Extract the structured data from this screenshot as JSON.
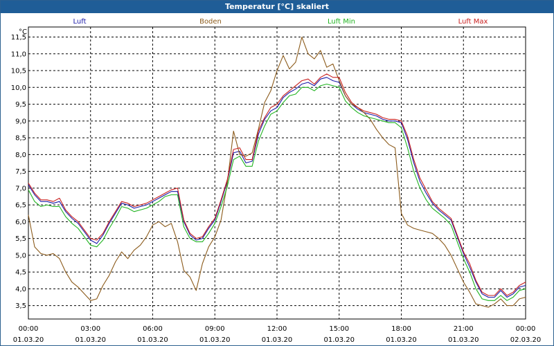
{
  "window": {
    "title": "Temperatur [°C] skaliert"
  },
  "chart_data": {
    "type": "line",
    "title": "Temperatur [°C] skaliert",
    "ylabel": "°C",
    "ylim": [
      3.1,
      11.8
    ],
    "yticks": [
      3.5,
      4.0,
      4.5,
      5.0,
      5.5,
      6.0,
      6.5,
      7.0,
      7.5,
      8.0,
      8.5,
      9.0,
      9.5,
      10.0,
      10.5,
      11.0,
      11.5
    ],
    "ytick_labels": [
      "3,5",
      "4,0",
      "4,5",
      "5,0",
      "5,5",
      "6,0",
      "6,5",
      "7,0",
      "7,5",
      "8,0",
      "8,5",
      "9,0",
      "9,5",
      "10,0",
      "10,5",
      "11,0",
      "11,5"
    ],
    "xlim": [
      0,
      24
    ],
    "xticks": [
      {
        "x": 0,
        "time": "00:00",
        "date": "01.03.20"
      },
      {
        "x": 3,
        "time": "03:00",
        "date": "01.03.20"
      },
      {
        "x": 6,
        "time": "06:00",
        "date": "01.03.20"
      },
      {
        "x": 9,
        "time": "09:00",
        "date": "01.03.20"
      },
      {
        "x": 12,
        "time": "12:00",
        "date": "01.03.20"
      },
      {
        "x": 15,
        "time": "15:00",
        "date": "01.03.20"
      },
      {
        "x": 18,
        "time": "18:00",
        "date": "01.03.20"
      },
      {
        "x": 21,
        "time": "21:00",
        "date": "01.03.20"
      },
      {
        "x": 24,
        "time": "00:00",
        "date": "02.03.20"
      }
    ],
    "grid": true,
    "legend_position": "top",
    "series": [
      {
        "name": "Luft",
        "color": "#1a1aa8",
        "x": [
          0,
          0.3,
          0.6,
          0.9,
          1.2,
          1.5,
          1.8,
          2.1,
          2.4,
          2.7,
          3.0,
          3.3,
          3.6,
          3.9,
          4.2,
          4.5,
          4.8,
          5.1,
          5.4,
          5.7,
          6.0,
          6.3,
          6.6,
          6.9,
          7.2,
          7.5,
          7.8,
          8.1,
          8.4,
          8.7,
          9.0,
          9.3,
          9.6,
          9.9,
          10.2,
          10.5,
          10.8,
          11.1,
          11.4,
          11.7,
          12.0,
          12.3,
          12.6,
          12.9,
          13.2,
          13.5,
          13.8,
          14.1,
          14.4,
          14.7,
          15.0,
          15.3,
          15.6,
          15.9,
          16.2,
          16.5,
          16.8,
          17.1,
          17.4,
          17.7,
          18.0,
          18.3,
          18.6,
          18.9,
          19.2,
          19.5,
          19.8,
          20.1,
          20.4,
          20.7,
          21.0,
          21.3,
          21.6,
          21.9,
          22.2,
          22.5,
          22.8,
          23.1,
          23.4,
          23.7,
          24.0
        ],
        "values": [
          7.1,
          6.8,
          6.6,
          6.6,
          6.55,
          6.6,
          6.3,
          6.1,
          5.95,
          5.7,
          5.45,
          5.35,
          5.6,
          5.95,
          6.25,
          6.55,
          6.5,
          6.4,
          6.45,
          6.5,
          6.6,
          6.7,
          6.8,
          6.9,
          6.9,
          6.0,
          5.6,
          5.45,
          5.5,
          5.8,
          6.05,
          6.6,
          7.2,
          8.05,
          8.1,
          7.75,
          7.8,
          8.6,
          9.05,
          9.3,
          9.4,
          9.7,
          9.85,
          9.95,
          10.1,
          10.15,
          10.05,
          10.25,
          10.3,
          10.2,
          10.15,
          9.75,
          9.5,
          9.35,
          9.25,
          9.2,
          9.15,
          9.05,
          9.0,
          9.0,
          8.95,
          8.45,
          7.75,
          7.2,
          6.85,
          6.55,
          6.35,
          6.2,
          6.05,
          5.55,
          5.05,
          4.65,
          4.2,
          3.85,
          3.75,
          3.75,
          3.95,
          3.75,
          3.85,
          4.05,
          4.1
        ]
      },
      {
        "name": "Boden",
        "color": "#8b5a1a",
        "x": [
          0,
          0.3,
          0.6,
          0.9,
          1.2,
          1.5,
          1.8,
          2.1,
          2.4,
          2.7,
          3.0,
          3.3,
          3.6,
          3.9,
          4.2,
          4.5,
          4.8,
          5.1,
          5.4,
          5.7,
          6.0,
          6.3,
          6.6,
          6.9,
          7.2,
          7.5,
          7.8,
          8.1,
          8.4,
          8.7,
          9.0,
          9.3,
          9.6,
          9.9,
          10.2,
          10.5,
          10.8,
          11.1,
          11.4,
          11.7,
          12.0,
          12.3,
          12.6,
          12.9,
          13.2,
          13.5,
          13.8,
          14.1,
          14.4,
          14.7,
          15.0,
          15.3,
          15.6,
          15.9,
          16.2,
          16.5,
          16.8,
          17.1,
          17.4,
          17.7,
          18.0,
          18.3,
          18.6,
          18.9,
          19.2,
          19.5,
          19.8,
          20.1,
          20.4,
          20.7,
          21.0,
          21.3,
          21.6,
          21.9,
          22.2,
          22.5,
          22.8,
          23.1,
          23.4,
          23.7,
          24.0
        ],
        "values": [
          6.2,
          5.25,
          5.05,
          5.0,
          5.05,
          4.9,
          4.5,
          4.2,
          4.05,
          3.85,
          3.65,
          3.7,
          4.1,
          4.4,
          4.8,
          5.1,
          4.9,
          5.15,
          5.3,
          5.55,
          5.9,
          6.0,
          5.85,
          5.95,
          5.4,
          4.55,
          4.35,
          3.95,
          4.75,
          5.25,
          5.55,
          6.05,
          7.15,
          8.7,
          8.0,
          7.95,
          8.05,
          8.75,
          9.55,
          9.9,
          10.5,
          10.95,
          10.55,
          10.75,
          11.5,
          11.0,
          10.85,
          11.1,
          10.6,
          10.7,
          10.2,
          9.75,
          9.5,
          9.4,
          9.25,
          9.05,
          8.75,
          8.5,
          8.3,
          8.2,
          6.25,
          5.9,
          5.8,
          5.75,
          5.7,
          5.65,
          5.5,
          5.3,
          5.0,
          4.6,
          4.2,
          3.9,
          3.55,
          3.5,
          3.45,
          3.55,
          3.7,
          3.5,
          3.5,
          3.7,
          3.75
        ]
      },
      {
        "name": "Luft Min",
        "color": "#1fb31f",
        "x": [
          0,
          0.3,
          0.6,
          0.9,
          1.2,
          1.5,
          1.8,
          2.1,
          2.4,
          2.7,
          3.0,
          3.3,
          3.6,
          3.9,
          4.2,
          4.5,
          4.8,
          5.1,
          5.4,
          5.7,
          6.0,
          6.3,
          6.6,
          6.9,
          7.2,
          7.5,
          7.8,
          8.1,
          8.4,
          8.7,
          9.0,
          9.3,
          9.6,
          9.9,
          10.2,
          10.5,
          10.8,
          11.1,
          11.4,
          11.7,
          12.0,
          12.3,
          12.6,
          12.9,
          13.2,
          13.5,
          13.8,
          14.1,
          14.4,
          14.7,
          15.0,
          15.3,
          15.6,
          15.9,
          16.2,
          16.5,
          16.8,
          17.1,
          17.4,
          17.7,
          18.0,
          18.3,
          18.6,
          18.9,
          19.2,
          19.5,
          19.8,
          20.1,
          20.4,
          20.7,
          21.0,
          21.3,
          21.6,
          21.9,
          22.2,
          22.5,
          22.8,
          23.1,
          23.4,
          23.7,
          24.0
        ],
        "values": [
          6.95,
          6.6,
          6.45,
          6.5,
          6.45,
          6.45,
          6.15,
          5.95,
          5.8,
          5.55,
          5.3,
          5.25,
          5.45,
          5.8,
          6.1,
          6.45,
          6.4,
          6.3,
          6.35,
          6.4,
          6.5,
          6.6,
          6.75,
          6.8,
          6.8,
          5.85,
          5.5,
          5.4,
          5.4,
          5.65,
          5.95,
          6.45,
          7.05,
          7.85,
          7.95,
          7.65,
          7.65,
          8.4,
          8.85,
          9.2,
          9.3,
          9.55,
          9.75,
          9.8,
          10.0,
          10.0,
          9.9,
          10.05,
          10.1,
          10.05,
          10.0,
          9.6,
          9.4,
          9.25,
          9.15,
          9.1,
          9.05,
          9.0,
          8.95,
          8.95,
          8.8,
          8.2,
          7.5,
          7.0,
          6.65,
          6.4,
          6.25,
          6.1,
          5.9,
          5.4,
          4.9,
          4.5,
          4.0,
          3.7,
          3.65,
          3.65,
          3.8,
          3.65,
          3.75,
          3.95,
          4.0
        ]
      },
      {
        "name": "Luft Max",
        "color": "#c81e1e",
        "x": [
          0,
          0.3,
          0.6,
          0.9,
          1.2,
          1.5,
          1.8,
          2.1,
          2.4,
          2.7,
          3.0,
          3.3,
          3.6,
          3.9,
          4.2,
          4.5,
          4.8,
          5.1,
          5.4,
          5.7,
          6.0,
          6.3,
          6.6,
          6.9,
          7.2,
          7.5,
          7.8,
          8.1,
          8.4,
          8.7,
          9.0,
          9.3,
          9.6,
          9.9,
          10.2,
          10.5,
          10.8,
          11.1,
          11.4,
          11.7,
          12.0,
          12.3,
          12.6,
          12.9,
          13.2,
          13.5,
          13.8,
          14.1,
          14.4,
          14.7,
          15.0,
          15.3,
          15.6,
          15.9,
          16.2,
          16.5,
          16.8,
          17.1,
          17.4,
          17.7,
          18.0,
          18.3,
          18.6,
          18.9,
          19.2,
          19.5,
          19.8,
          20.1,
          20.4,
          20.7,
          21.0,
          21.3,
          21.6,
          21.9,
          22.2,
          22.5,
          22.8,
          23.1,
          23.4,
          23.7,
          24.0
        ],
        "values": [
          7.15,
          6.85,
          6.65,
          6.65,
          6.6,
          6.7,
          6.35,
          6.15,
          6.0,
          5.75,
          5.5,
          5.45,
          5.65,
          6.0,
          6.3,
          6.6,
          6.55,
          6.45,
          6.5,
          6.55,
          6.65,
          6.75,
          6.85,
          6.95,
          7.0,
          6.05,
          5.65,
          5.5,
          5.55,
          5.85,
          6.1,
          6.65,
          7.25,
          8.15,
          8.2,
          7.85,
          7.85,
          8.7,
          9.1,
          9.4,
          9.5,
          9.75,
          9.9,
          10.05,
          10.2,
          10.25,
          10.1,
          10.3,
          10.4,
          10.3,
          10.3,
          9.85,
          9.55,
          9.4,
          9.3,
          9.25,
          9.2,
          9.1,
          9.05,
          9.05,
          9.0,
          8.55,
          7.85,
          7.3,
          6.95,
          6.6,
          6.4,
          6.25,
          6.1,
          5.6,
          5.1,
          4.75,
          4.25,
          3.9,
          3.8,
          3.8,
          4.0,
          3.8,
          3.9,
          4.1,
          4.2
        ]
      }
    ]
  }
}
